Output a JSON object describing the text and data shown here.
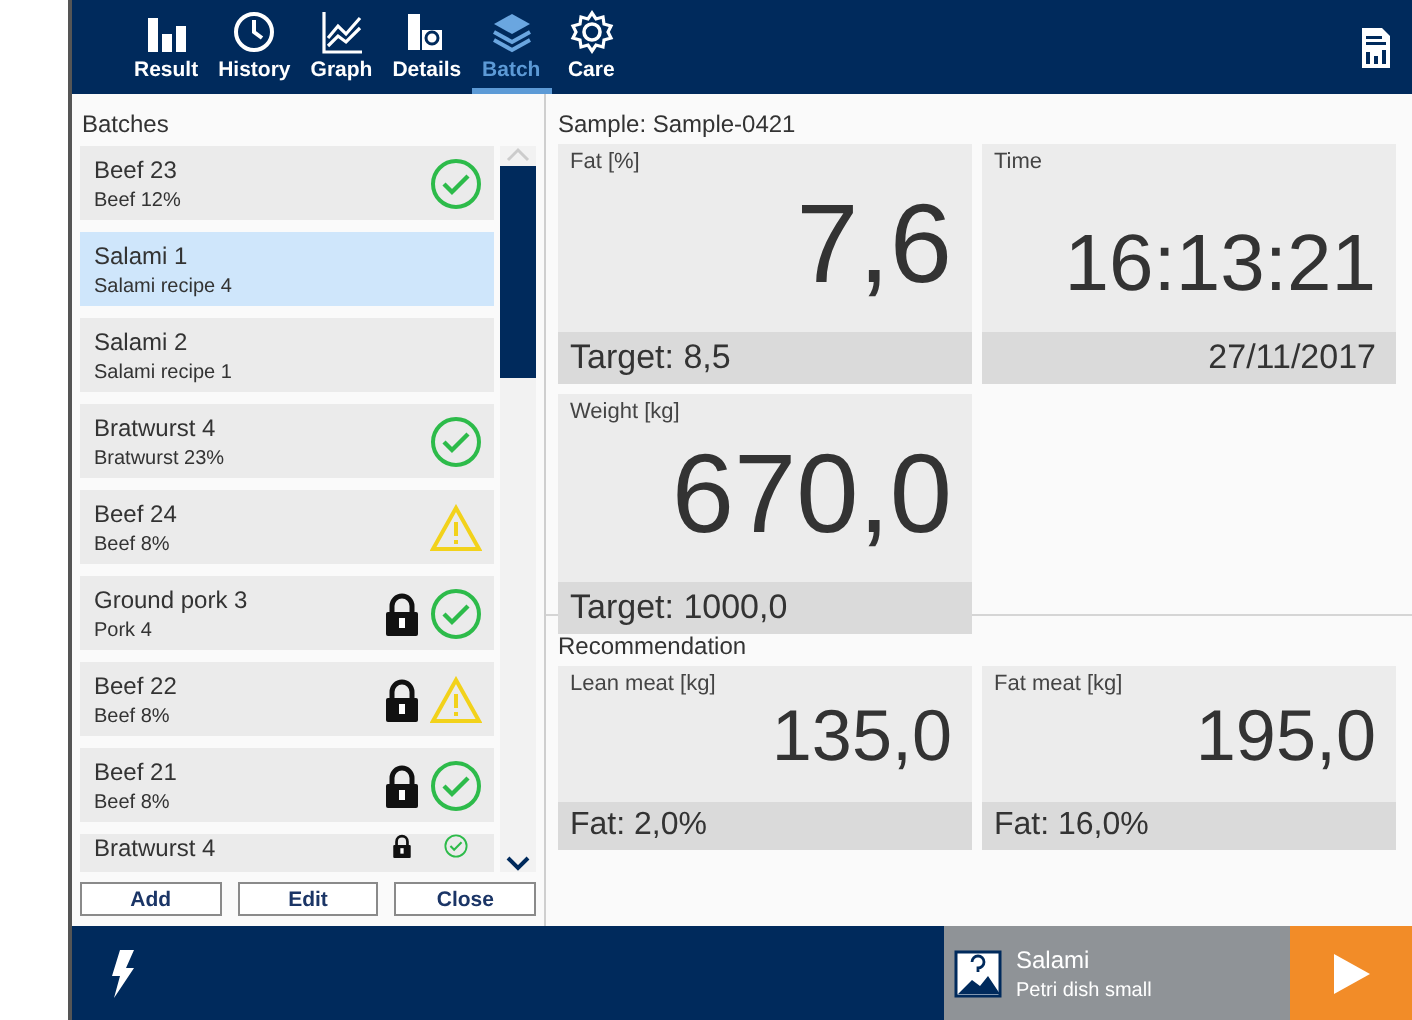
{
  "tabs": [
    {
      "label": "Result",
      "selected": false
    },
    {
      "label": "History",
      "selected": false
    },
    {
      "label": "Graph",
      "selected": false
    },
    {
      "label": "Details",
      "selected": false
    },
    {
      "label": "Batch",
      "selected": true
    },
    {
      "label": "Care",
      "selected": false
    }
  ],
  "batches": {
    "title": "Batches",
    "rows": [
      {
        "kind": "ok",
        "name": "Beef 23",
        "recipe": "Beef 12%",
        "locked": false,
        "selected": false
      },
      {
        "kind": "plain",
        "name": "Salami 1",
        "recipe": "Salami recipe 4",
        "locked": false,
        "selected": true
      },
      {
        "kind": "plain",
        "name": "Salami 2",
        "recipe": "Salami recipe 1",
        "locked": false,
        "selected": false
      },
      {
        "kind": "ok",
        "name": "Bratwurst 4",
        "recipe": "Bratwurst 23%",
        "locked": false,
        "selected": false
      },
      {
        "kind": "warning",
        "name": "Beef 24",
        "recipe": "Beef 8%",
        "locked": false,
        "selected": false
      },
      {
        "kind": "ok",
        "name": "Ground pork 3",
        "recipe": "Pork 4",
        "locked": true,
        "selected": false
      },
      {
        "kind": "warning",
        "name": "Beef 22",
        "recipe": "Beef 8%",
        "locked": true,
        "selected": false
      },
      {
        "kind": "ok",
        "name": "Beef 21",
        "recipe": "Beef 8%",
        "locked": true,
        "selected": false
      },
      {
        "kind": "ok",
        "name": "Bratwurst 4",
        "locked": true,
        "selected": false
      }
    ],
    "buttons": [
      "Add",
      "Edit",
      "Close"
    ]
  },
  "sample": {
    "title": "Sample: Sample-0421",
    "cards": [
      {
        "kind": "measure",
        "label": "Fat [%]",
        "value": "7,6",
        "footer": "Target: 8,5"
      },
      {
        "kind": "clock",
        "label": "Time",
        "value": "16:13:21",
        "footer": "27/11/2017"
      },
      {
        "kind": "measure",
        "label": "Weight [kg]",
        "value": "670,0",
        "footer": "Target: 1000,0"
      }
    ]
  },
  "recommendation": {
    "title": "Recommendation",
    "cards": [
      {
        "label": "Lean meat [kg]",
        "value": "135,0",
        "footer": "Fat: 2,0%"
      },
      {
        "label": "Fat meat [kg]",
        "value": "195,0",
        "footer": "Fat: 16,0%"
      }
    ]
  },
  "product": {
    "name": "Salami",
    "dish": "Petri dish small"
  }
}
